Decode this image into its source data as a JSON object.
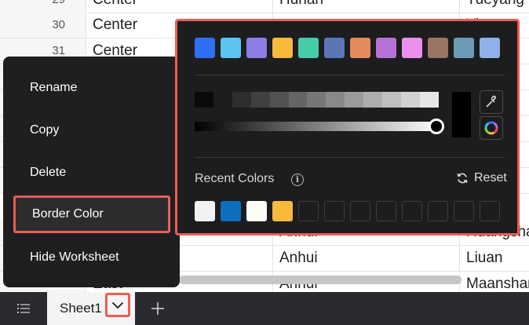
{
  "grid": {
    "rows": [
      {
        "num": "29",
        "c1": "Center",
        "c2": "Hunan",
        "c3": "Yueyang"
      },
      {
        "num": "30",
        "c1": "Center",
        "c2": "",
        "c3": "Yiyang"
      },
      {
        "num": "31",
        "c1": "Center",
        "c2": "",
        "c3": ""
      },
      {
        "num": "",
        "c1": "",
        "c2": "",
        "c3": ""
      },
      {
        "num": "",
        "c1": "",
        "c2": "",
        "c3": ""
      },
      {
        "num": "",
        "c1": "",
        "c2": "",
        "c3": ""
      },
      {
        "num": "",
        "c1": "",
        "c2": "",
        "c3": ""
      },
      {
        "num": "",
        "c1": "",
        "c2": "",
        "c3": ""
      },
      {
        "num": "",
        "c1": "",
        "c2": "Anhui",
        "c3": "Huangshan"
      },
      {
        "num": "",
        "c1": "",
        "c2": "Anhui",
        "c3": "Liuan"
      },
      {
        "num": "",
        "c1": "East",
        "c2": "Anhui",
        "c3": "Maanshan"
      }
    ]
  },
  "context_menu": {
    "items": [
      "Rename",
      "Copy",
      "Delete",
      "Border Color",
      "Hide Worksheet"
    ],
    "highlighted": "Border Color"
  },
  "color_picker": {
    "palette": [
      "#2f6ff5",
      "#5bc4f2",
      "#8c7ce6",
      "#f6b93b",
      "#45cca9",
      "#5b75b8",
      "#e58a5c",
      "#b772d7",
      "#ec90ec",
      "#9b7563",
      "#6d9bb3",
      "#8fb0e8"
    ],
    "grayscale": [
      "#0a0a0a",
      "#1c1c1c",
      "#2e2e2e",
      "#404040",
      "#525252",
      "#656565",
      "#777777",
      "#898989",
      "#9b9b9b",
      "#adadad",
      "#bfbfbf",
      "#d2d2d2",
      "#e6e6e6"
    ],
    "lightness_value": 1.0,
    "preview_color": "#000000",
    "eyedropper_icon": "eyedropper-icon",
    "color_wheel_icon": "color-wheel-icon",
    "recent_label": "Recent Colors",
    "reset_label": "Reset",
    "recent_colors": [
      "#f2f2f2",
      "#0d6ebe",
      "#fdfdf8",
      "#f6b93b"
    ],
    "recent_empty_slots": 8
  },
  "sheet_bar": {
    "sheet_name": "Sheet1",
    "list_icon": "list-icon",
    "add_icon": "plus-icon",
    "dropdown_icon": "chevron-down-icon"
  },
  "colors": {
    "highlight": "#ea5d55",
    "menu_bg": "#1f1f21",
    "picker_bg": "#1d1d1f"
  }
}
